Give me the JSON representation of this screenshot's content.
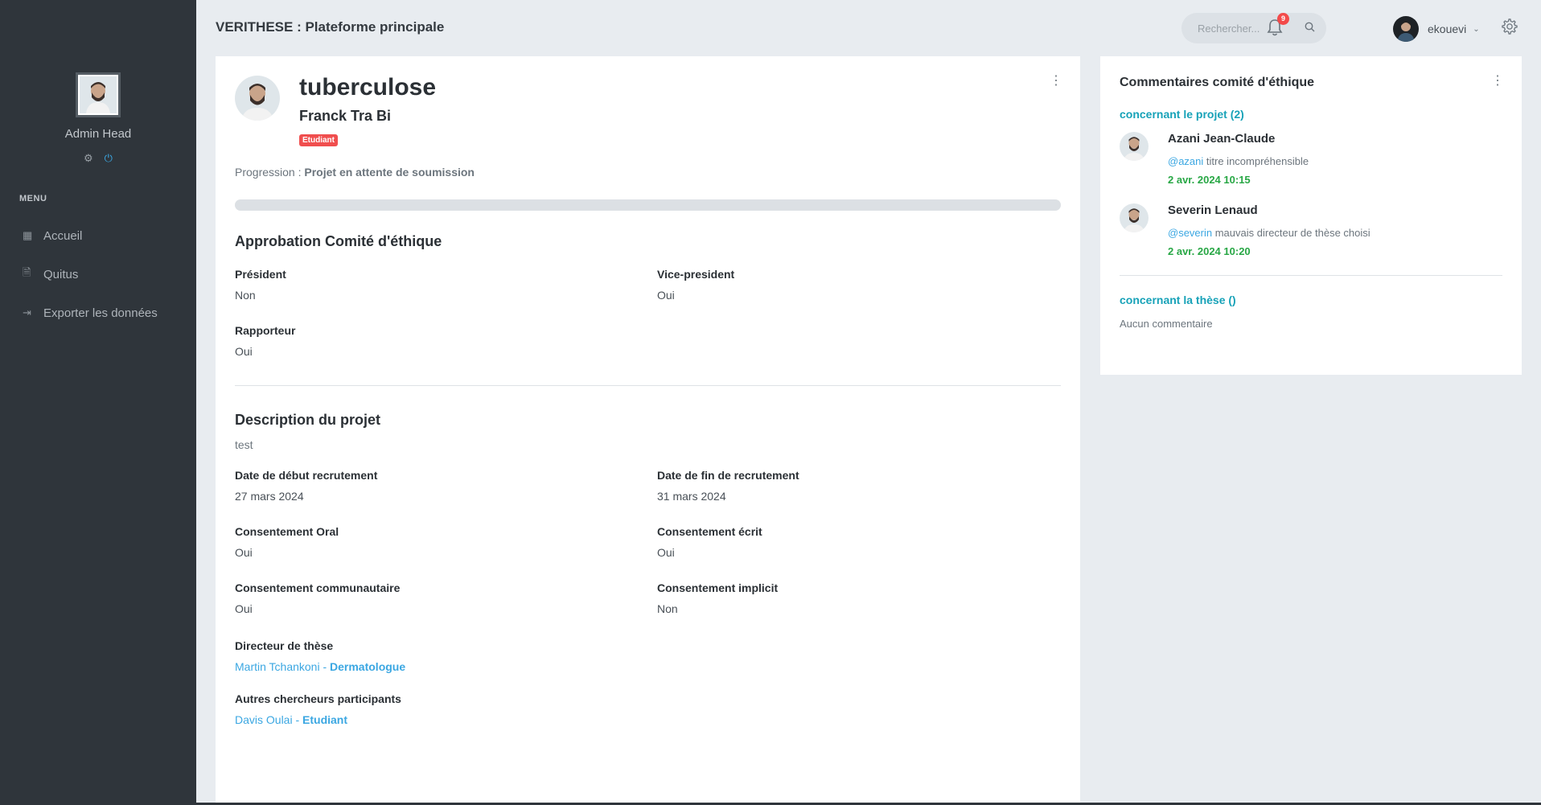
{
  "sidebar": {
    "profile_name": "Admin Head",
    "menu_title": "MENU",
    "items": [
      {
        "label": "Accueil",
        "icon": "table-icon"
      },
      {
        "label": "Quitus",
        "icon": "document-icon"
      },
      {
        "label": "Exporter les données",
        "icon": "sign-out-icon"
      }
    ]
  },
  "topbar": {
    "title": "VERITHESE : Plateforme principale",
    "search_placeholder": "Rechercher...",
    "notification_count": "9",
    "username": "ekouevi"
  },
  "project": {
    "title": "tuberculose",
    "student_name": "Franck Tra Bi",
    "role_badge": "Etudiant",
    "progression_label": "Progression :",
    "progression_status": "Projet en attente de soumission",
    "progress_fraction": 0
  },
  "approval": {
    "title": "Approbation Comité d'éthique",
    "fields": [
      {
        "label": "Président",
        "value": "Non"
      },
      {
        "label": "Vice-president",
        "value": "Oui"
      },
      {
        "label": "Rapporteur",
        "value": "Oui"
      }
    ]
  },
  "description": {
    "title": "Description du projet",
    "text": "test",
    "fields": [
      {
        "label": "Date de début recrutement",
        "value": "27 mars 2024"
      },
      {
        "label": "Date de fin de recrutement",
        "value": "31 mars 2024"
      },
      {
        "label": "Consentement Oral",
        "value": "Oui"
      },
      {
        "label": "Consentement écrit",
        "value": "Oui"
      },
      {
        "label": "Consentement communautaire",
        "value": "Oui"
      },
      {
        "label": "Consentement implicit",
        "value": "Non"
      }
    ],
    "director_label": "Directeur de thèse",
    "director_name": "Martin Tchankoni - ",
    "director_role": "Dermatologue",
    "others_label": "Autres chercheurs participants",
    "other_name": "Davis Oulai - ",
    "other_role": "Etudiant"
  },
  "comments": {
    "title": "Commentaires comité d'éthique",
    "project_section": "concernant le projet (2)",
    "items": [
      {
        "author": "Azani Jean-Claude",
        "mention": "@azani",
        "text": " titre incompréhensible",
        "date": "2 avr. 2024 10:15"
      },
      {
        "author": "Severin Lenaud",
        "mention": "@severin",
        "text": " mauvais directeur de thèse choisi",
        "date": "2 avr. 2024 10:20"
      }
    ],
    "thesis_section": "concernant la thèse ()",
    "empty_text": "Aucun commentaire"
  },
  "colors": {
    "sidebar_bg": "#2f353b",
    "accent_blue": "#3ba7e2",
    "accent_teal": "#17a2b8",
    "badge_red": "#f04e4e",
    "date_green": "#28a745"
  }
}
